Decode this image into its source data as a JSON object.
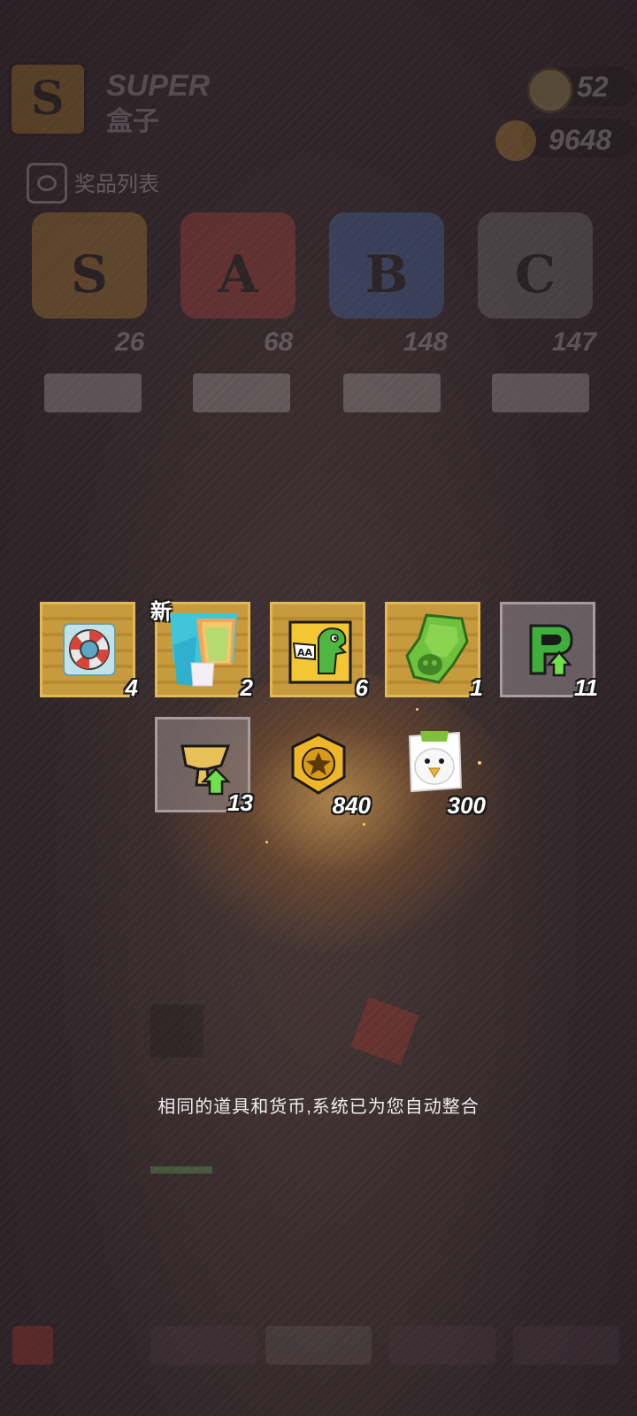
{
  "header": {
    "logo_letter": "S",
    "title_en": "SUPER",
    "title_cn": "盒子",
    "coin_count": "52",
    "chicken_count": "9648"
  },
  "prize_list_label": "奖品列表",
  "boxes": [
    {
      "letter": "S",
      "count": "26",
      "color": "#d59b34"
    },
    {
      "letter": "A",
      "count": "68",
      "color": "#d14a40"
    },
    {
      "letter": "B",
      "count": "148",
      "color": "#4a7ccf"
    },
    {
      "letter": "C",
      "count": "147",
      "color": "#8a8a8a"
    }
  ],
  "items": [
    {
      "name": "life-ring-icon",
      "count": "4",
      "frame": "gold",
      "is_new": false
    },
    {
      "name": "rainbow-outfit-icon",
      "count": "2",
      "frame": "gold",
      "is_new": true,
      "new_label": "新"
    },
    {
      "name": "dino-sticker-icon",
      "count": "6",
      "frame": "gold",
      "is_new": false
    },
    {
      "name": "green-spray-icon",
      "count": "1",
      "frame": "gold",
      "is_new": false
    },
    {
      "name": "rank-up-card-icon",
      "count": "11",
      "frame": "gray",
      "is_new": false
    },
    {
      "name": "trophy-up-card-icon",
      "count": "13",
      "frame": "gray",
      "is_new": false
    },
    {
      "name": "star-coin-icon",
      "count": "840",
      "frame": "none",
      "is_new": false
    },
    {
      "name": "duck-token-icon",
      "count": "300",
      "frame": "none",
      "is_new": false
    }
  ],
  "toast_text": "相同的道具和货币,系统已为您自动整合",
  "colors": {
    "gold_frame": "#c79a3e",
    "gray_frame": "#a79b9f",
    "background": "#3a2e33"
  }
}
